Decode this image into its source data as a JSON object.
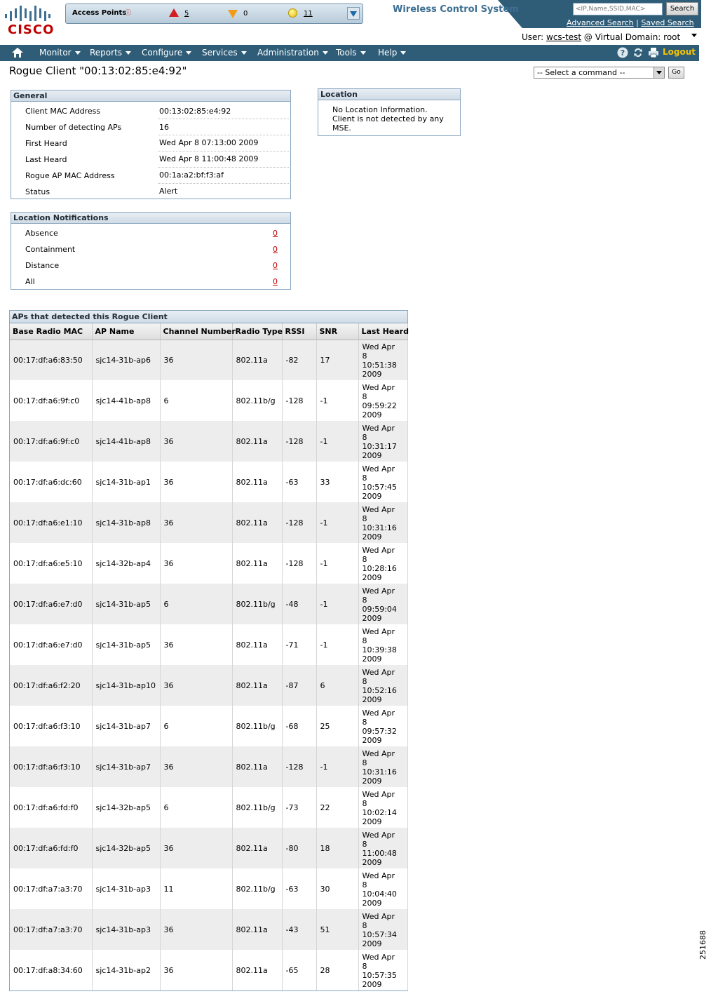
{
  "header": {
    "logo_text": "CISCO",
    "app_title": "Wireless Control System",
    "search_placeholder": "<IP,Name,SSID,MAC>",
    "search_button": "Search",
    "advanced_search": "Advanced Search",
    "saved_search": "Saved Search",
    "separator": "|",
    "user_label": "User:",
    "user_name": "wcs-test",
    "domain_text": "@ Virtual Domain:",
    "domain_value": "root"
  },
  "access_points": {
    "label": "Access Points",
    "info_icon": "info-icon",
    "critical": "5",
    "major": "0",
    "minor": "11"
  },
  "nav": {
    "items": [
      "Monitor",
      "Reports",
      "Configure",
      "Services",
      "Administration",
      "Tools",
      "Help"
    ],
    "logout": "Logout"
  },
  "page": {
    "title": "Rogue Client  \"00:13:02:85:e4:92\"",
    "command_placeholder": "-- Select a command --",
    "go_button": "Go"
  },
  "general": {
    "title": "General",
    "rows": [
      {
        "label": "Client MAC Address",
        "value": "00:13:02:85:e4:92"
      },
      {
        "label": "Number of detecting APs",
        "value": "16"
      },
      {
        "label": "First Heard",
        "value": "Wed Apr 8 07:13:00 2009"
      },
      {
        "label": "Last Heard",
        "value": "Wed Apr 8 11:00:48 2009"
      },
      {
        "label": "Rogue AP MAC Address",
        "value": "00:1a:a2:bf:f3:af"
      },
      {
        "label": "Status",
        "value": "Alert"
      }
    ]
  },
  "location": {
    "title": "Location",
    "message_lines": [
      "No Location Information.",
      "Client is not detected by any",
      "MSE."
    ]
  },
  "notifications": {
    "title": "Location Notifications",
    "rows": [
      {
        "label": "Absence",
        "value": "0"
      },
      {
        "label": "Containment",
        "value": "0"
      },
      {
        "label": "Distance",
        "value": "0"
      },
      {
        "label": "All",
        "value": "0"
      }
    ]
  },
  "ap_table": {
    "title": "APs that detected this Rogue Client",
    "columns": [
      "Base Radio MAC",
      "AP Name",
      "Channel Number",
      "Radio Type",
      "RSSI",
      "SNR",
      "Last Heard"
    ],
    "rows": [
      {
        "mac": "00:17:df:a6:83:50",
        "ap": "sjc14-31b-ap6",
        "ch": "36",
        "radio": "802.11a",
        "rssi": "-82",
        "snr": "17",
        "heard": [
          "Wed Apr",
          "8",
          "10:51:38",
          "2009"
        ]
      },
      {
        "mac": "00:17:df:a6:9f:c0",
        "ap": "sjc14-41b-ap8",
        "ch": "6",
        "radio": "802.11b/g",
        "rssi": "-128",
        "snr": "-1",
        "heard": [
          "Wed Apr",
          "8",
          "09:59:22",
          "2009"
        ]
      },
      {
        "mac": "00:17:df:a6:9f:c0",
        "ap": "sjc14-41b-ap8",
        "ch": "36",
        "radio": "802.11a",
        "rssi": "-128",
        "snr": "-1",
        "heard": [
          "Wed Apr",
          "8",
          "10:31:17",
          "2009"
        ]
      },
      {
        "mac": "00:17:df:a6:dc:60",
        "ap": "sjc14-31b-ap1",
        "ch": "36",
        "radio": "802.11a",
        "rssi": "-63",
        "snr": "33",
        "heard": [
          "Wed Apr",
          "8",
          "10:57:45",
          "2009"
        ]
      },
      {
        "mac": "00:17:df:a6:e1:10",
        "ap": "sjc14-31b-ap8",
        "ch": "36",
        "radio": "802.11a",
        "rssi": "-128",
        "snr": "-1",
        "heard": [
          "Wed Apr",
          "8",
          "10:31:16",
          "2009"
        ]
      },
      {
        "mac": "00:17:df:a6:e5:10",
        "ap": "sjc14-32b-ap4",
        "ch": "36",
        "radio": "802.11a",
        "rssi": "-128",
        "snr": "-1",
        "heard": [
          "Wed Apr",
          "8",
          "10:28:16",
          "2009"
        ]
      },
      {
        "mac": "00:17:df:a6:e7:d0",
        "ap": "sjc14-31b-ap5",
        "ch": "6",
        "radio": "802.11b/g",
        "rssi": "-48",
        "snr": "-1",
        "heard": [
          "Wed Apr",
          "8",
          "09:59:04",
          "2009"
        ]
      },
      {
        "mac": "00:17:df:a6:e7:d0",
        "ap": "sjc14-31b-ap5",
        "ch": "36",
        "radio": "802.11a",
        "rssi": "-71",
        "snr": "-1",
        "heard": [
          "Wed Apr",
          "8",
          "10:39:38",
          "2009"
        ]
      },
      {
        "mac": "00:17:df:a6:f2:20",
        "ap": "sjc14-31b-ap10",
        "ch": "36",
        "radio": "802.11a",
        "rssi": "-87",
        "snr": "6",
        "heard": [
          "Wed Apr",
          "8",
          "10:52:16",
          "2009"
        ]
      },
      {
        "mac": "00:17:df:a6:f3:10",
        "ap": "sjc14-31b-ap7",
        "ch": "6",
        "radio": "802.11b/g",
        "rssi": "-68",
        "snr": "25",
        "heard": [
          "Wed Apr",
          "8",
          "09:57:32",
          "2009"
        ]
      },
      {
        "mac": "00:17:df:a6:f3:10",
        "ap": "sjc14-31b-ap7",
        "ch": "36",
        "radio": "802.11a",
        "rssi": "-128",
        "snr": "-1",
        "heard": [
          "Wed Apr",
          "8",
          "10:31:16",
          "2009"
        ]
      },
      {
        "mac": "00:17:df:a6:fd:f0",
        "ap": "sjc14-32b-ap5",
        "ch": "6",
        "radio": "802.11b/g",
        "rssi": "-73",
        "snr": "22",
        "heard": [
          "Wed Apr",
          "8",
          "10:02:14",
          "2009"
        ]
      },
      {
        "mac": "00:17:df:a6:fd:f0",
        "ap": "sjc14-32b-ap5",
        "ch": "36",
        "radio": "802.11a",
        "rssi": "-80",
        "snr": "18",
        "heard": [
          "Wed Apr",
          "8",
          "11:00:48",
          "2009"
        ]
      },
      {
        "mac": "00:17:df:a7:a3:70",
        "ap": "sjc14-31b-ap3",
        "ch": "11",
        "radio": "802.11b/g",
        "rssi": "-63",
        "snr": "30",
        "heard": [
          "Wed Apr",
          "8",
          "10:04:40",
          "2009"
        ]
      },
      {
        "mac": "00:17:df:a7:a3:70",
        "ap": "sjc14-31b-ap3",
        "ch": "36",
        "radio": "802.11a",
        "rssi": "-43",
        "snr": "51",
        "heard": [
          "Wed Apr",
          "8",
          "10:57:34",
          "2009"
        ]
      },
      {
        "mac": "00:17:df:a8:34:60",
        "ap": "sjc14-31b-ap2",
        "ch": "36",
        "radio": "802.11a",
        "rssi": "-65",
        "snr": "28",
        "heard": [
          "Wed Apr",
          "8",
          "10:57:35",
          "2009"
        ]
      }
    ]
  },
  "figure_id": "251688",
  "colors": {
    "nav_bg": "#2f5d78",
    "brand_red": "#c00000",
    "logout": "#f6c500",
    "link_red": "#c00000"
  }
}
